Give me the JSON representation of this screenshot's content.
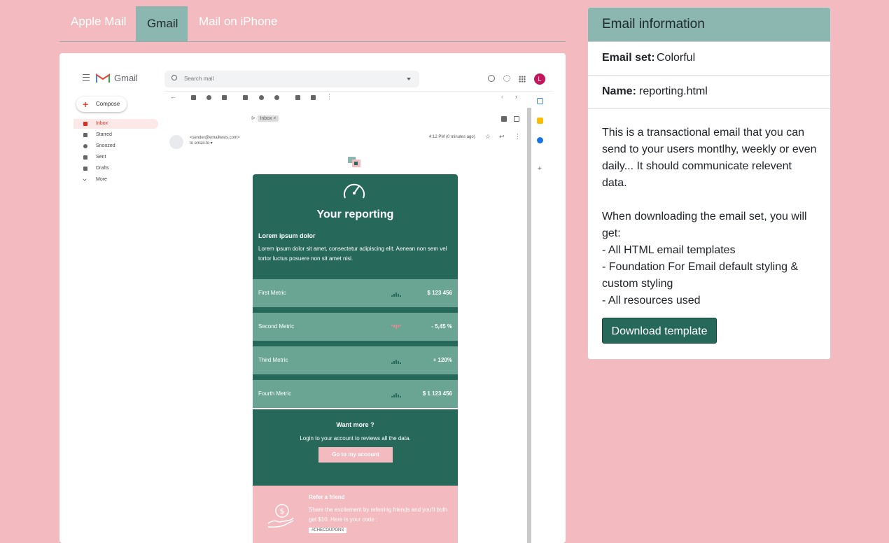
{
  "tabs": [
    {
      "label": "Apple Mail"
    },
    {
      "label": "Gmail"
    },
    {
      "label": "Mail on iPhone"
    }
  ],
  "gmail": {
    "app_name": "Gmail",
    "search_placeholder": "Search mail",
    "avatar_letter": "L",
    "compose_label": "Compose",
    "folders": [
      {
        "label": "Inbox",
        "icon": "inbox-icon"
      },
      {
        "label": "Starred",
        "icon": "star-icon"
      },
      {
        "label": "Snoozed",
        "icon": "clock-icon"
      },
      {
        "label": "Sent",
        "icon": "send-icon"
      },
      {
        "label": "Drafts",
        "icon": "draft-icon"
      },
      {
        "label": "More",
        "icon": "chevron-down-icon"
      }
    ],
    "inbox_chip": "Inbox ×",
    "sender": "<sender@emailtests.com>",
    "to": "to email-to ▾",
    "time": "4:12 PM (0 minutes ago)"
  },
  "email": {
    "title": "Your reporting",
    "lead_heading": "Lorem ipsum dolor",
    "lead_body": "Lorem ipsum dolor sit amet, consectetur adipiscing elit. Aenean non sem vel tortor luctus posuere non sit amet nisi.",
    "metrics": [
      {
        "name": "First Metric",
        "value": "$ 123 456",
        "trend": "up"
      },
      {
        "name": "Second Metric",
        "value": "- 5,45 %",
        "trend": "down"
      },
      {
        "name": "Third Metric",
        "value": "+ 120%",
        "trend": "up"
      },
      {
        "name": "Fourth Metric",
        "value": "$ 1 123 456",
        "trend": "up"
      }
    ],
    "cta_heading": "Want more ?",
    "cta_sub": "Login to your account to reviews all the data.",
    "cta_button": "Go to my account",
    "refer_title": "Refer a friend",
    "refer_body": "Share the excitement by referring friends and you'll both get $10. Here is your code :",
    "refer_code": "#CHECOUPONS"
  },
  "info": {
    "header": "Email information",
    "set_label": "Email set:",
    "set_value": "Colorful",
    "name_label": "Name:",
    "name_value": "reporting.html",
    "desc1": "This is a transactional email that you can send to your users montlhy, weekly or even daily... It should communicate relevent data.",
    "desc2": "When downloading the email set, you will get:",
    "bullets": [
      "- All HTML email templates",
      "- Foundation For Email default styling & custom styling",
      "- All resources used"
    ],
    "download_label": "Download template"
  },
  "colors": {
    "background": "#f3bbc0",
    "accent": "#26685a",
    "tab_active": "#8bb7b0",
    "metric_row": "#6aa493"
  }
}
